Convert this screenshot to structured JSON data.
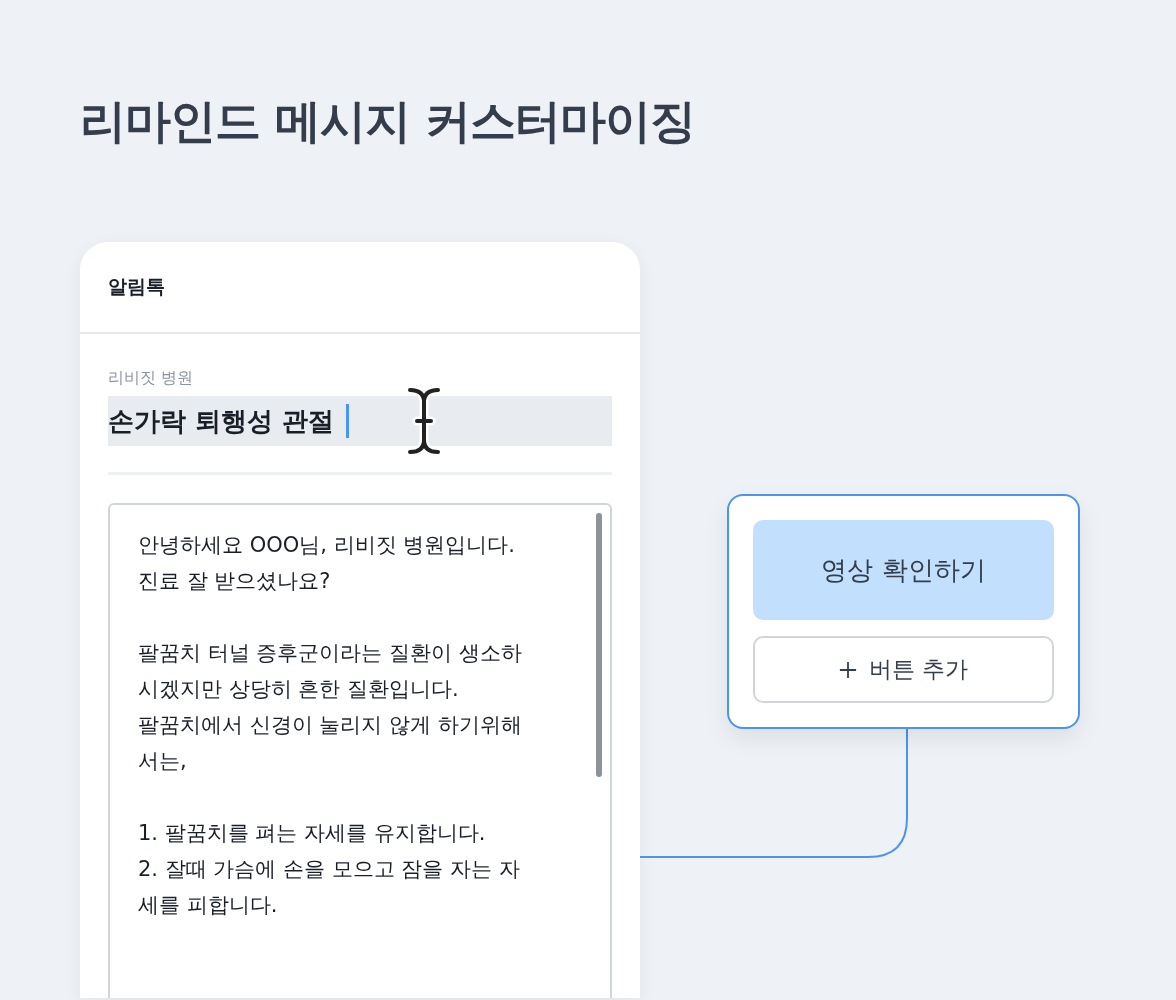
{
  "heading": "리마인드 메시지 커스터마이징",
  "message_card": {
    "channel": "알림톡",
    "sender_label": "리비짓 병원",
    "title_field": {
      "value": "손가락 퇴행성 관절",
      "highlighted": true
    },
    "body_paragraphs": [
      [
        "안녕하세요 OOO님, 리비짓 병원입니다.",
        "진료 잘 받으셨나요?"
      ],
      [
        "팔꿈치 터널 증후군이라는 질환이 생소하",
        "시겠지만 상당히 흔한 질환입니다.",
        "팔꿈치에서 신경이 눌리지 않게 하기위해",
        "서는,"
      ],
      [
        "1. 팔꿈치를 펴는 자세를 유지합니다.",
        "2. 잘때 가슴에 손을 모으고 잠을 자는 자",
        "세를 피합니다."
      ]
    ]
  },
  "button_panel": {
    "buttons": [
      {
        "label": "영상 확인하기",
        "kind": "primary"
      },
      {
        "label": "버튼 추가",
        "kind": "add"
      }
    ]
  }
}
